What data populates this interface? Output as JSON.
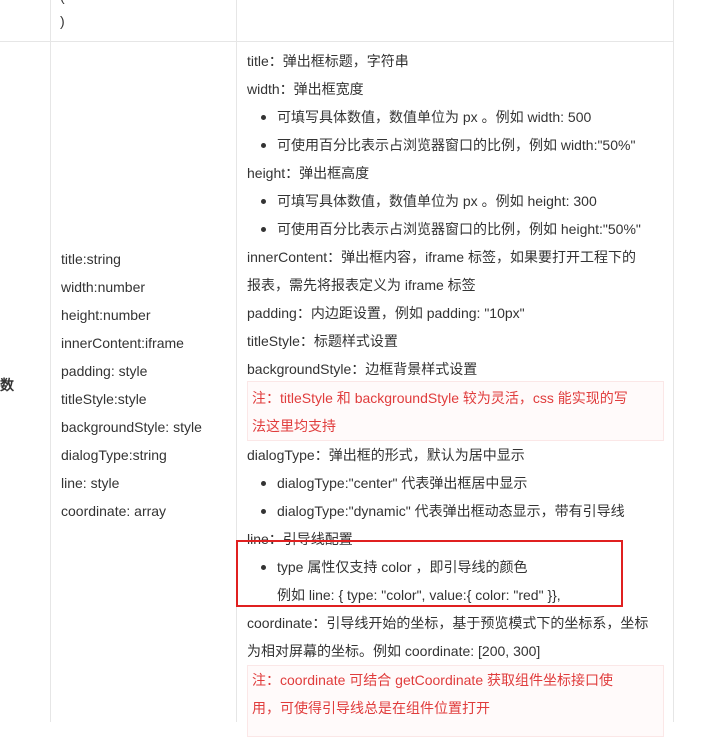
{
  "prev_row": {
    "closing": ")"
  },
  "row": {
    "label": "数",
    "params": [
      "title:string",
      "width:number",
      "height:number",
      "innerContent:iframe",
      "padding: style",
      "titleStyle:style",
      "backgroundStyle: style",
      "dialogType:string",
      "line: style",
      "coordinate: array"
    ],
    "desc": {
      "title": "title：弹出框标题，字符串",
      "width": "width：弹出框宽度",
      "width_bullets": [
        "可填写具体数值，数值单位为 px 。例如 width: 500",
        "可使用百分比表示占浏览器窗口的比例，例如 width:\"50%\""
      ],
      "height": "height：弹出框高度",
      "height_bullets": [
        "可填写具体数值，数值单位为 px 。例如 height: 300",
        "可使用百分比表示占浏览器窗口的比例，例如 height:\"50%\""
      ],
      "inner_line1": "innerContent：弹出框内容，iframe 标签，如果要打开工程下的",
      "inner_line2": "报表，需先将报表定义为 iframe 标签",
      "padding": "padding：内边距设置，例如 padding: \"10px\"",
      "titleStyle": "titleStyle：标题样式设置",
      "backgroundStyle": "backgroundStyle：边框背景样式设置",
      "note1_line1": "注：titleStyle 和 backgroundStyle 较为灵活，css 能实现的写",
      "note1_line2": "法这里均支持",
      "dialogType": "dialogType：弹出框的形式，默认为居中显示",
      "dialog_bullets": [
        "dialogType:\"center\" 代表弹出框居中显示",
        "dialogType:\"dynamic\" 代表弹出框动态显示，带有引导线"
      ],
      "line": "line：引导线配置",
      "line_bullet": "type 属性仅支持 color ，即引导线的颜色",
      "line_example": "例如 line: { type: \"color\", value:{ color: \"red\" }},",
      "coord_line1": "coordinate：引导线开始的坐标，基于预览模式下的坐标系，坐标",
      "coord_line2": "为相对屏幕的坐标。例如 coordinate: [200, 300]",
      "note2_line1": "注：coordinate 可结合 getCoordinate 获取组件坐标接口使",
      "note2_line2": "用，可使得引导线总是在组件位置打开"
    }
  },
  "colors": {
    "note_text": "#e03c3c",
    "highlight_border": "#e02020",
    "text": "#333333"
  }
}
